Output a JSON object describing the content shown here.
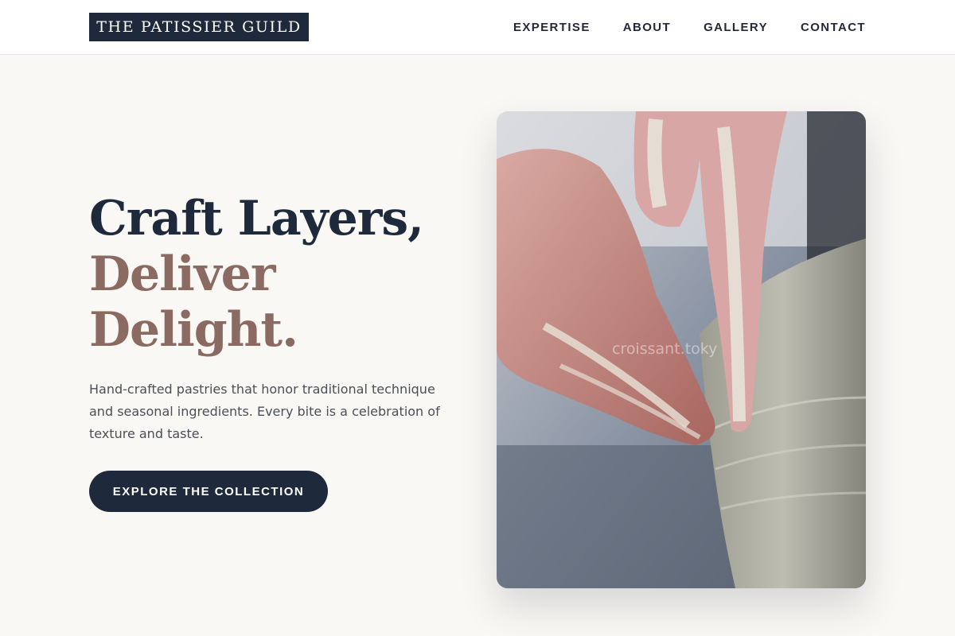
{
  "brand": {
    "name": "THE PATISSIER GUILD"
  },
  "nav": {
    "items": [
      "EXPERTISE",
      "ABOUT",
      "GALLERY",
      "CONTACT"
    ]
  },
  "hero": {
    "headline_line1": "Craft Layers,",
    "headline_line2": "Deliver",
    "headline_line3": "Delight.",
    "description": "Hand-crafted pastries that honor traditional technique and seasonal ingredients. Every bite is a celebration of texture and taste.",
    "cta_label": "EXPLORE THE COLLECTION",
    "image_watermark": "croissant.toky"
  },
  "colors": {
    "primary": "#1e293b",
    "accent": "#8b6a61",
    "background": "#faf8f5",
    "body_text": "#4b4f56"
  }
}
